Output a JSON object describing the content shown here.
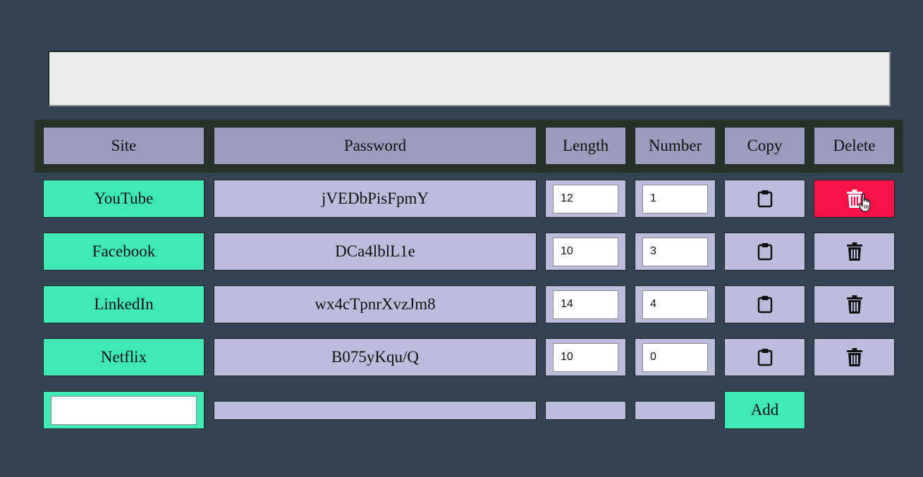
{
  "top_field": {
    "value": ""
  },
  "headers": {
    "site": "Site",
    "password": "Password",
    "length": "Length",
    "number": "Number",
    "copy": "Copy",
    "delete": "Delete"
  },
  "rows": [
    {
      "site": "YouTube",
      "password": "jVEDbPisFpmY",
      "length": "12",
      "number": "1"
    },
    {
      "site": "Facebook",
      "password": "DCa4lblL1e",
      "length": "10",
      "number": "3"
    },
    {
      "site": "LinkedIn",
      "password": "wx4cTpnrXvzJm8",
      "length": "14",
      "number": "4"
    },
    {
      "site": "Netflix",
      "password": "B075yKqu/Q",
      "length": "10",
      "number": "0"
    }
  ],
  "new_row": {
    "site_value": "",
    "add_label": "Add"
  },
  "icons": {
    "copy": "clipboard-icon",
    "delete": "trash-icon",
    "cursor": "hand-pointer-cursor"
  },
  "colors": {
    "background": "#344455",
    "header": "#9a9bbe",
    "site": "#40e8b6",
    "cell": "#bcbcde",
    "delete_hover": "#f71348"
  }
}
